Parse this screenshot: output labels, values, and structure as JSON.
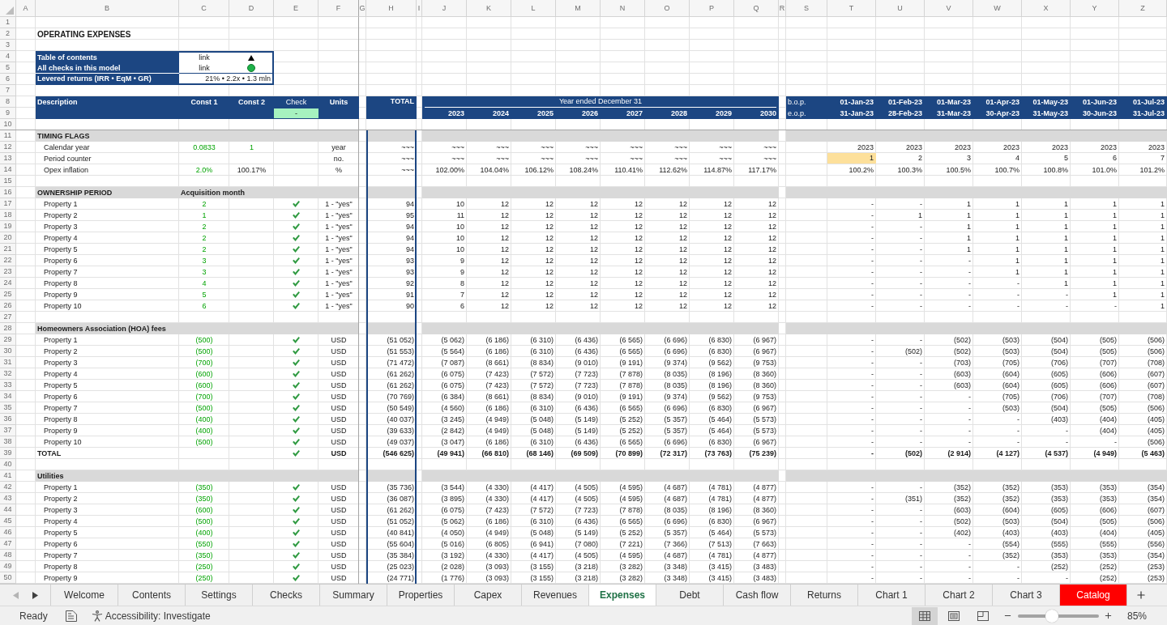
{
  "column_headers": [
    "A",
    "B",
    "C",
    "D",
    "E",
    "F",
    "G",
    "H",
    "I",
    "J",
    "K",
    "L",
    "M",
    "N",
    "O",
    "P",
    "Q",
    "R",
    "S",
    "T",
    "U",
    "V",
    "W",
    "X",
    "Y",
    "Z"
  ],
  "row_numbers": [
    "1",
    "2",
    "3",
    "4",
    "5",
    "6",
    "7",
    "8",
    "9",
    "10",
    "11",
    "12",
    "13",
    "14",
    "15",
    "16",
    "17",
    "18",
    "19",
    "20",
    "21",
    "22",
    "23",
    "24",
    "25",
    "26",
    "27",
    "28",
    "29",
    "30",
    "31",
    "32",
    "33",
    "34",
    "35",
    "36",
    "37",
    "38",
    "39",
    "40",
    "41",
    "42",
    "43",
    "44",
    "45",
    "46",
    "47",
    "48",
    "49",
    "50"
  ],
  "title": "OPERATING EXPENSES",
  "info_box": [
    {
      "kind": "nav_link",
      "label": "Table of contents",
      "value": "link"
    },
    {
      "kind": "check_link",
      "label": "All checks in this model",
      "value": "link",
      "ok": true
    },
    {
      "kind": "metric",
      "label": "Levered returns (IRR • EqM • GR)",
      "value": "21% • 2.2x • 1.3 mln"
    }
  ],
  "header": {
    "description": "Description",
    "const_1": "Const 1",
    "const_2": "Const 2",
    "check": "Check",
    "check_status": "-",
    "check_ok": true,
    "units": "Units",
    "total": "TOTAL",
    "period_title": "Year ended December 31",
    "years": [
      "2023",
      "2024",
      "2025",
      "2026",
      "2027",
      "2028",
      "2029",
      "2030"
    ],
    "bop": "b.o.p.",
    "eop": "e.o.p.",
    "period_starts": [
      "01-Jan-23",
      "01-Feb-23",
      "01-Mar-23",
      "01-Apr-23",
      "01-May-23",
      "01-Jun-23",
      "01-Jul-23"
    ],
    "period_ends": [
      "31-Jan-23",
      "28-Feb-23",
      "31-Mar-23",
      "30-Apr-23",
      "31-May-23",
      "30-Jun-23",
      "31-Jul-23"
    ]
  },
  "sections": [
    {
      "title": "TIMING FLAGS",
      "rows": [
        {
          "kind": "item",
          "label": "Calendar year",
          "const_1": {
            "text": "0.0833",
            "input": true
          },
          "const_2": {
            "text": "1",
            "input": true
          },
          "check": false,
          "units": "year",
          "total": "~~~",
          "annual": [
            "~~~",
            "~~~",
            "~~~",
            "~~~",
            "~~~",
            "~~~",
            "~~~",
            "~~~"
          ],
          "monthly": [
            "2023",
            "2023",
            "2023",
            "2023",
            "2023",
            "2023",
            "2023"
          ]
        },
        {
          "kind": "item",
          "label": "Period counter",
          "check": false,
          "units": "no.",
          "total": "~~~",
          "annual": [
            "~~~",
            "~~~",
            "~~~",
            "~~~",
            "~~~",
            "~~~",
            "~~~",
            "~~~"
          ],
          "monthly": [
            "1",
            "2",
            "3",
            "4",
            "5",
            "6",
            "7"
          ],
          "monthly_highlighted": [
            true,
            false,
            false,
            false,
            false,
            false,
            false
          ]
        },
        {
          "kind": "item",
          "label": "Opex inflation",
          "const_1": {
            "text": "2.0%",
            "input": true
          },
          "const_2": {
            "text": "100.17%",
            "input": false
          },
          "check": false,
          "units": "%",
          "total": "~~~",
          "annual": [
            "102.00%",
            "104.04%",
            "106.12%",
            "108.24%",
            "110.41%",
            "112.62%",
            "114.87%",
            "117.17%"
          ],
          "monthly": [
            "100.2%",
            "100.3%",
            "100.5%",
            "100.7%",
            "100.8%",
            "101.0%",
            "101.2%"
          ]
        }
      ]
    },
    {
      "title": "OWNERSHIP PERIOD",
      "subheader": "Acquisition month",
      "rows": [
        {
          "kind": "item",
          "label": "Property 1",
          "const_1": {
            "text": "2",
            "input": true
          },
          "check": true,
          "units": "1 - \"yes\"",
          "total": "94",
          "annual": [
            "10",
            "12",
            "12",
            "12",
            "12",
            "12",
            "12",
            "12"
          ],
          "monthly": [
            "-",
            "-",
            "1",
            "1",
            "1",
            "1",
            "1"
          ]
        },
        {
          "kind": "item",
          "label": "Property 2",
          "const_1": {
            "text": "1",
            "input": true
          },
          "check": true,
          "units": "1 - \"yes\"",
          "total": "95",
          "annual": [
            "11",
            "12",
            "12",
            "12",
            "12",
            "12",
            "12",
            "12"
          ],
          "monthly": [
            "-",
            "1",
            "1",
            "1",
            "1",
            "1",
            "1"
          ]
        },
        {
          "kind": "item",
          "label": "Property 3",
          "const_1": {
            "text": "2",
            "input": true
          },
          "check": true,
          "units": "1 - \"yes\"",
          "total": "94",
          "annual": [
            "10",
            "12",
            "12",
            "12",
            "12",
            "12",
            "12",
            "12"
          ],
          "monthly": [
            "-",
            "-",
            "1",
            "1",
            "1",
            "1",
            "1"
          ]
        },
        {
          "kind": "item",
          "label": "Property 4",
          "const_1": {
            "text": "2",
            "input": true
          },
          "check": true,
          "units": "1 - \"yes\"",
          "total": "94",
          "annual": [
            "10",
            "12",
            "12",
            "12",
            "12",
            "12",
            "12",
            "12"
          ],
          "monthly": [
            "-",
            "-",
            "1",
            "1",
            "1",
            "1",
            "1"
          ]
        },
        {
          "kind": "item",
          "label": "Property 5",
          "const_1": {
            "text": "2",
            "input": true
          },
          "check": true,
          "units": "1 - \"yes\"",
          "total": "94",
          "annual": [
            "10",
            "12",
            "12",
            "12",
            "12",
            "12",
            "12",
            "12"
          ],
          "monthly": [
            "-",
            "-",
            "1",
            "1",
            "1",
            "1",
            "1"
          ]
        },
        {
          "kind": "item",
          "label": "Property 6",
          "const_1": {
            "text": "3",
            "input": true
          },
          "check": true,
          "units": "1 - \"yes\"",
          "total": "93",
          "annual": [
            "9",
            "12",
            "12",
            "12",
            "12",
            "12",
            "12",
            "12"
          ],
          "monthly": [
            "-",
            "-",
            "-",
            "1",
            "1",
            "1",
            "1"
          ]
        },
        {
          "kind": "item",
          "label": "Property 7",
          "const_1": {
            "text": "3",
            "input": true
          },
          "check": true,
          "units": "1 - \"yes\"",
          "total": "93",
          "annual": [
            "9",
            "12",
            "12",
            "12",
            "12",
            "12",
            "12",
            "12"
          ],
          "monthly": [
            "-",
            "-",
            "-",
            "1",
            "1",
            "1",
            "1"
          ]
        },
        {
          "kind": "item",
          "label": "Property 8",
          "const_1": {
            "text": "4",
            "input": true
          },
          "check": true,
          "units": "1 - \"yes\"",
          "total": "92",
          "annual": [
            "8",
            "12",
            "12",
            "12",
            "12",
            "12",
            "12",
            "12"
          ],
          "monthly": [
            "-",
            "-",
            "-",
            "-",
            "1",
            "1",
            "1"
          ]
        },
        {
          "kind": "item",
          "label": "Property 9",
          "const_1": {
            "text": "5",
            "input": true
          },
          "check": true,
          "units": "1 - \"yes\"",
          "total": "91",
          "annual": [
            "7",
            "12",
            "12",
            "12",
            "12",
            "12",
            "12",
            "12"
          ],
          "monthly": [
            "-",
            "-",
            "-",
            "-",
            "-",
            "1",
            "1"
          ]
        },
        {
          "kind": "item",
          "label": "Property 10",
          "const_1": {
            "text": "6",
            "input": true
          },
          "check": true,
          "units": "1 - \"yes\"",
          "total": "90",
          "annual": [
            "6",
            "12",
            "12",
            "12",
            "12",
            "12",
            "12",
            "12"
          ],
          "monthly": [
            "-",
            "-",
            "-",
            "-",
            "-",
            "-",
            "1"
          ]
        }
      ]
    },
    {
      "title": "Homeowners Association (HOA) fees",
      "rows": [
        {
          "kind": "item",
          "label": "Property 1",
          "const_1": {
            "text": "(500)",
            "input": true
          },
          "check": true,
          "units": "USD",
          "total": "(51 052)",
          "annual": [
            "(5 062)",
            "(6 186)",
            "(6 310)",
            "(6 436)",
            "(6 565)",
            "(6 696)",
            "(6 830)",
            "(6 967)"
          ],
          "monthly": [
            "-",
            "-",
            "(502)",
            "(503)",
            "(504)",
            "(505)",
            "(506)"
          ]
        },
        {
          "kind": "item",
          "label": "Property 2",
          "const_1": {
            "text": "(500)",
            "input": true
          },
          "check": true,
          "units": "USD",
          "total": "(51 553)",
          "annual": [
            "(5 564)",
            "(6 186)",
            "(6 310)",
            "(6 436)",
            "(6 565)",
            "(6 696)",
            "(6 830)",
            "(6 967)"
          ],
          "monthly": [
            "-",
            "(502)",
            "(502)",
            "(503)",
            "(504)",
            "(505)",
            "(506)"
          ]
        },
        {
          "kind": "item",
          "label": "Property 3",
          "const_1": {
            "text": "(700)",
            "input": true
          },
          "check": true,
          "units": "USD",
          "total": "(71 472)",
          "annual": [
            "(7 087)",
            "(8 661)",
            "(8 834)",
            "(9 010)",
            "(9 191)",
            "(9 374)",
            "(9 562)",
            "(9 753)"
          ],
          "monthly": [
            "-",
            "-",
            "(703)",
            "(705)",
            "(706)",
            "(707)",
            "(708)"
          ]
        },
        {
          "kind": "item",
          "label": "Property 4",
          "const_1": {
            "text": "(600)",
            "input": true
          },
          "check": true,
          "units": "USD",
          "total": "(61 262)",
          "annual": [
            "(6 075)",
            "(7 423)",
            "(7 572)",
            "(7 723)",
            "(7 878)",
            "(8 035)",
            "(8 196)",
            "(8 360)"
          ],
          "monthly": [
            "-",
            "-",
            "(603)",
            "(604)",
            "(605)",
            "(606)",
            "(607)"
          ]
        },
        {
          "kind": "item",
          "label": "Property 5",
          "const_1": {
            "text": "(600)",
            "input": true
          },
          "check": true,
          "units": "USD",
          "total": "(61 262)",
          "annual": [
            "(6 075)",
            "(7 423)",
            "(7 572)",
            "(7 723)",
            "(7 878)",
            "(8 035)",
            "(8 196)",
            "(8 360)"
          ],
          "monthly": [
            "-",
            "-",
            "(603)",
            "(604)",
            "(605)",
            "(606)",
            "(607)"
          ]
        },
        {
          "kind": "item",
          "label": "Property 6",
          "const_1": {
            "text": "(700)",
            "input": true
          },
          "check": true,
          "units": "USD",
          "total": "(70 769)",
          "annual": [
            "(6 384)",
            "(8 661)",
            "(8 834)",
            "(9 010)",
            "(9 191)",
            "(9 374)",
            "(9 562)",
            "(9 753)"
          ],
          "monthly": [
            "-",
            "-",
            "-",
            "(705)",
            "(706)",
            "(707)",
            "(708)"
          ]
        },
        {
          "kind": "item",
          "label": "Property 7",
          "const_1": {
            "text": "(500)",
            "input": true
          },
          "check": true,
          "units": "USD",
          "total": "(50 549)",
          "annual": [
            "(4 560)",
            "(6 186)",
            "(6 310)",
            "(6 436)",
            "(6 565)",
            "(6 696)",
            "(6 830)",
            "(6 967)"
          ],
          "monthly": [
            "-",
            "-",
            "-",
            "(503)",
            "(504)",
            "(505)",
            "(506)"
          ]
        },
        {
          "kind": "item",
          "label": "Property 8",
          "const_1": {
            "text": "(400)",
            "input": true
          },
          "check": true,
          "units": "USD",
          "total": "(40 037)",
          "annual": [
            "(3 245)",
            "(4 949)",
            "(5 048)",
            "(5 149)",
            "(5 252)",
            "(5 357)",
            "(5 464)",
            "(5 573)"
          ],
          "monthly": [
            "-",
            "-",
            "-",
            "-",
            "(403)",
            "(404)",
            "(405)"
          ]
        },
        {
          "kind": "item",
          "label": "Property 9",
          "const_1": {
            "text": "(400)",
            "input": true
          },
          "check": true,
          "units": "USD",
          "total": "(39 633)",
          "annual": [
            "(2 842)",
            "(4 949)",
            "(5 048)",
            "(5 149)",
            "(5 252)",
            "(5 357)",
            "(5 464)",
            "(5 573)"
          ],
          "monthly": [
            "-",
            "-",
            "-",
            "-",
            "-",
            "(404)",
            "(405)"
          ]
        },
        {
          "kind": "item",
          "label": "Property 10",
          "const_1": {
            "text": "(500)",
            "input": true
          },
          "check": true,
          "units": "USD",
          "total": "(49 037)",
          "annual": [
            "(3 047)",
            "(6 186)",
            "(6 310)",
            "(6 436)",
            "(6 565)",
            "(6 696)",
            "(6 830)",
            "(6 967)"
          ],
          "monthly": [
            "-",
            "-",
            "-",
            "-",
            "-",
            "-",
            "(506)"
          ]
        },
        {
          "kind": "total",
          "label": "TOTAL",
          "check": true,
          "units": "USD",
          "total": "(546 625)",
          "annual": [
            "(49 941)",
            "(66 810)",
            "(68 146)",
            "(69 509)",
            "(70 899)",
            "(72 317)",
            "(73 763)",
            "(75 239)"
          ],
          "monthly": [
            "-",
            "(502)",
            "(2 914)",
            "(4 127)",
            "(4 537)",
            "(4 949)",
            "(5 463)"
          ]
        }
      ]
    },
    {
      "title": "Utilities",
      "rows": [
        {
          "kind": "item",
          "label": "Property 1",
          "const_1": {
            "text": "(350)",
            "input": true
          },
          "check": true,
          "units": "USD",
          "total": "(35 736)",
          "annual": [
            "(3 544)",
            "(4 330)",
            "(4 417)",
            "(4 505)",
            "(4 595)",
            "(4 687)",
            "(4 781)",
            "(4 877)"
          ],
          "monthly": [
            "-",
            "-",
            "(352)",
            "(352)",
            "(353)",
            "(353)",
            "(354)"
          ]
        },
        {
          "kind": "item",
          "label": "Property 2",
          "const_1": {
            "text": "(350)",
            "input": true
          },
          "check": true,
          "units": "USD",
          "total": "(36 087)",
          "annual": [
            "(3 895)",
            "(4 330)",
            "(4 417)",
            "(4 505)",
            "(4 595)",
            "(4 687)",
            "(4 781)",
            "(4 877)"
          ],
          "monthly": [
            "-",
            "(351)",
            "(352)",
            "(352)",
            "(353)",
            "(353)",
            "(354)"
          ]
        },
        {
          "kind": "item",
          "label": "Property 3",
          "const_1": {
            "text": "(600)",
            "input": true
          },
          "check": true,
          "units": "USD",
          "total": "(61 262)",
          "annual": [
            "(6 075)",
            "(7 423)",
            "(7 572)",
            "(7 723)",
            "(7 878)",
            "(8 035)",
            "(8 196)",
            "(8 360)"
          ],
          "monthly": [
            "-",
            "-",
            "(603)",
            "(604)",
            "(605)",
            "(606)",
            "(607)"
          ]
        },
        {
          "kind": "item",
          "label": "Property 4",
          "const_1": {
            "text": "(500)",
            "input": true
          },
          "check": true,
          "units": "USD",
          "total": "(51 052)",
          "annual": [
            "(5 062)",
            "(6 186)",
            "(6 310)",
            "(6 436)",
            "(6 565)",
            "(6 696)",
            "(6 830)",
            "(6 967)"
          ],
          "monthly": [
            "-",
            "-",
            "(502)",
            "(503)",
            "(504)",
            "(505)",
            "(506)"
          ]
        },
        {
          "kind": "item",
          "label": "Property 5",
          "const_1": {
            "text": "(400)",
            "input": true
          },
          "check": true,
          "units": "USD",
          "total": "(40 841)",
          "annual": [
            "(4 050)",
            "(4 949)",
            "(5 048)",
            "(5 149)",
            "(5 252)",
            "(5 357)",
            "(5 464)",
            "(5 573)"
          ],
          "monthly": [
            "-",
            "-",
            "(402)",
            "(403)",
            "(403)",
            "(404)",
            "(405)"
          ]
        },
        {
          "kind": "item",
          "label": "Property 6",
          "const_1": {
            "text": "(550)",
            "input": true
          },
          "check": true,
          "units": "USD",
          "total": "(55 604)",
          "annual": [
            "(5 016)",
            "(6 805)",
            "(6 941)",
            "(7 080)",
            "(7 221)",
            "(7 366)",
            "(7 513)",
            "(7 663)"
          ],
          "monthly": [
            "-",
            "-",
            "-",
            "(554)",
            "(555)",
            "(555)",
            "(556)"
          ]
        },
        {
          "kind": "item",
          "label": "Property 7",
          "const_1": {
            "text": "(350)",
            "input": true
          },
          "check": true,
          "units": "USD",
          "total": "(35 384)",
          "annual": [
            "(3 192)",
            "(4 330)",
            "(4 417)",
            "(4 505)",
            "(4 595)",
            "(4 687)",
            "(4 781)",
            "(4 877)"
          ],
          "monthly": [
            "-",
            "-",
            "-",
            "(352)",
            "(353)",
            "(353)",
            "(354)"
          ]
        },
        {
          "kind": "item",
          "label": "Property 8",
          "const_1": {
            "text": "(250)",
            "input": true
          },
          "check": true,
          "units": "USD",
          "total": "(25 023)",
          "annual": [
            "(2 028)",
            "(3 093)",
            "(3 155)",
            "(3 218)",
            "(3 282)",
            "(3 348)",
            "(3 415)",
            "(3 483)"
          ],
          "monthly": [
            "-",
            "-",
            "-",
            "-",
            "(252)",
            "(252)",
            "(253)"
          ]
        },
        {
          "kind": "item",
          "label": "Property 9",
          "const_1": {
            "text": "(250)",
            "input": true
          },
          "check": true,
          "units": "USD",
          "total": "(24 771)",
          "annual": [
            "(1 776)",
            "(3 093)",
            "(3 155)",
            "(3 218)",
            "(3 282)",
            "(3 348)",
            "(3 415)",
            "(3 483)"
          ],
          "monthly": [
            "-",
            "-",
            "-",
            "-",
            "-",
            "(252)",
            "(253)"
          ]
        }
      ]
    }
  ],
  "sheet_nav": [
    {
      "kind": "previous",
      "disabled": true
    },
    {
      "kind": "next",
      "disabled": false
    }
  ],
  "sheet_tabs": [
    {
      "label": "Welcome",
      "selected": false
    },
    {
      "label": "Contents",
      "selected": false
    },
    {
      "label": "Settings",
      "selected": false
    },
    {
      "label": "Checks",
      "selected": false
    },
    {
      "label": "Summary",
      "selected": false
    },
    {
      "label": "Properties",
      "selected": false
    },
    {
      "label": "Capex",
      "selected": false
    },
    {
      "label": "Revenues",
      "selected": false
    },
    {
      "label": "Expenses",
      "selected": true
    },
    {
      "label": "Debt",
      "selected": false
    },
    {
      "label": "Cash flow",
      "selected": false
    },
    {
      "label": "Returns",
      "selected": false
    },
    {
      "label": "Chart 1",
      "selected": false
    },
    {
      "label": "Chart 2",
      "selected": false
    },
    {
      "label": "Chart 3",
      "selected": false
    },
    {
      "label": "Catalog",
      "selected": false,
      "color": "#ff0000"
    }
  ],
  "status_bar": {
    "status": "Ready",
    "accessibility": "Accessibility: Investigate",
    "views": [
      {
        "kind": "normal",
        "selected": true
      },
      {
        "kind": "page_layout",
        "selected": false
      },
      {
        "kind": "page_break",
        "selected": false
      }
    ],
    "zoom": {
      "level": 0.41,
      "reading": "85%"
    }
  }
}
